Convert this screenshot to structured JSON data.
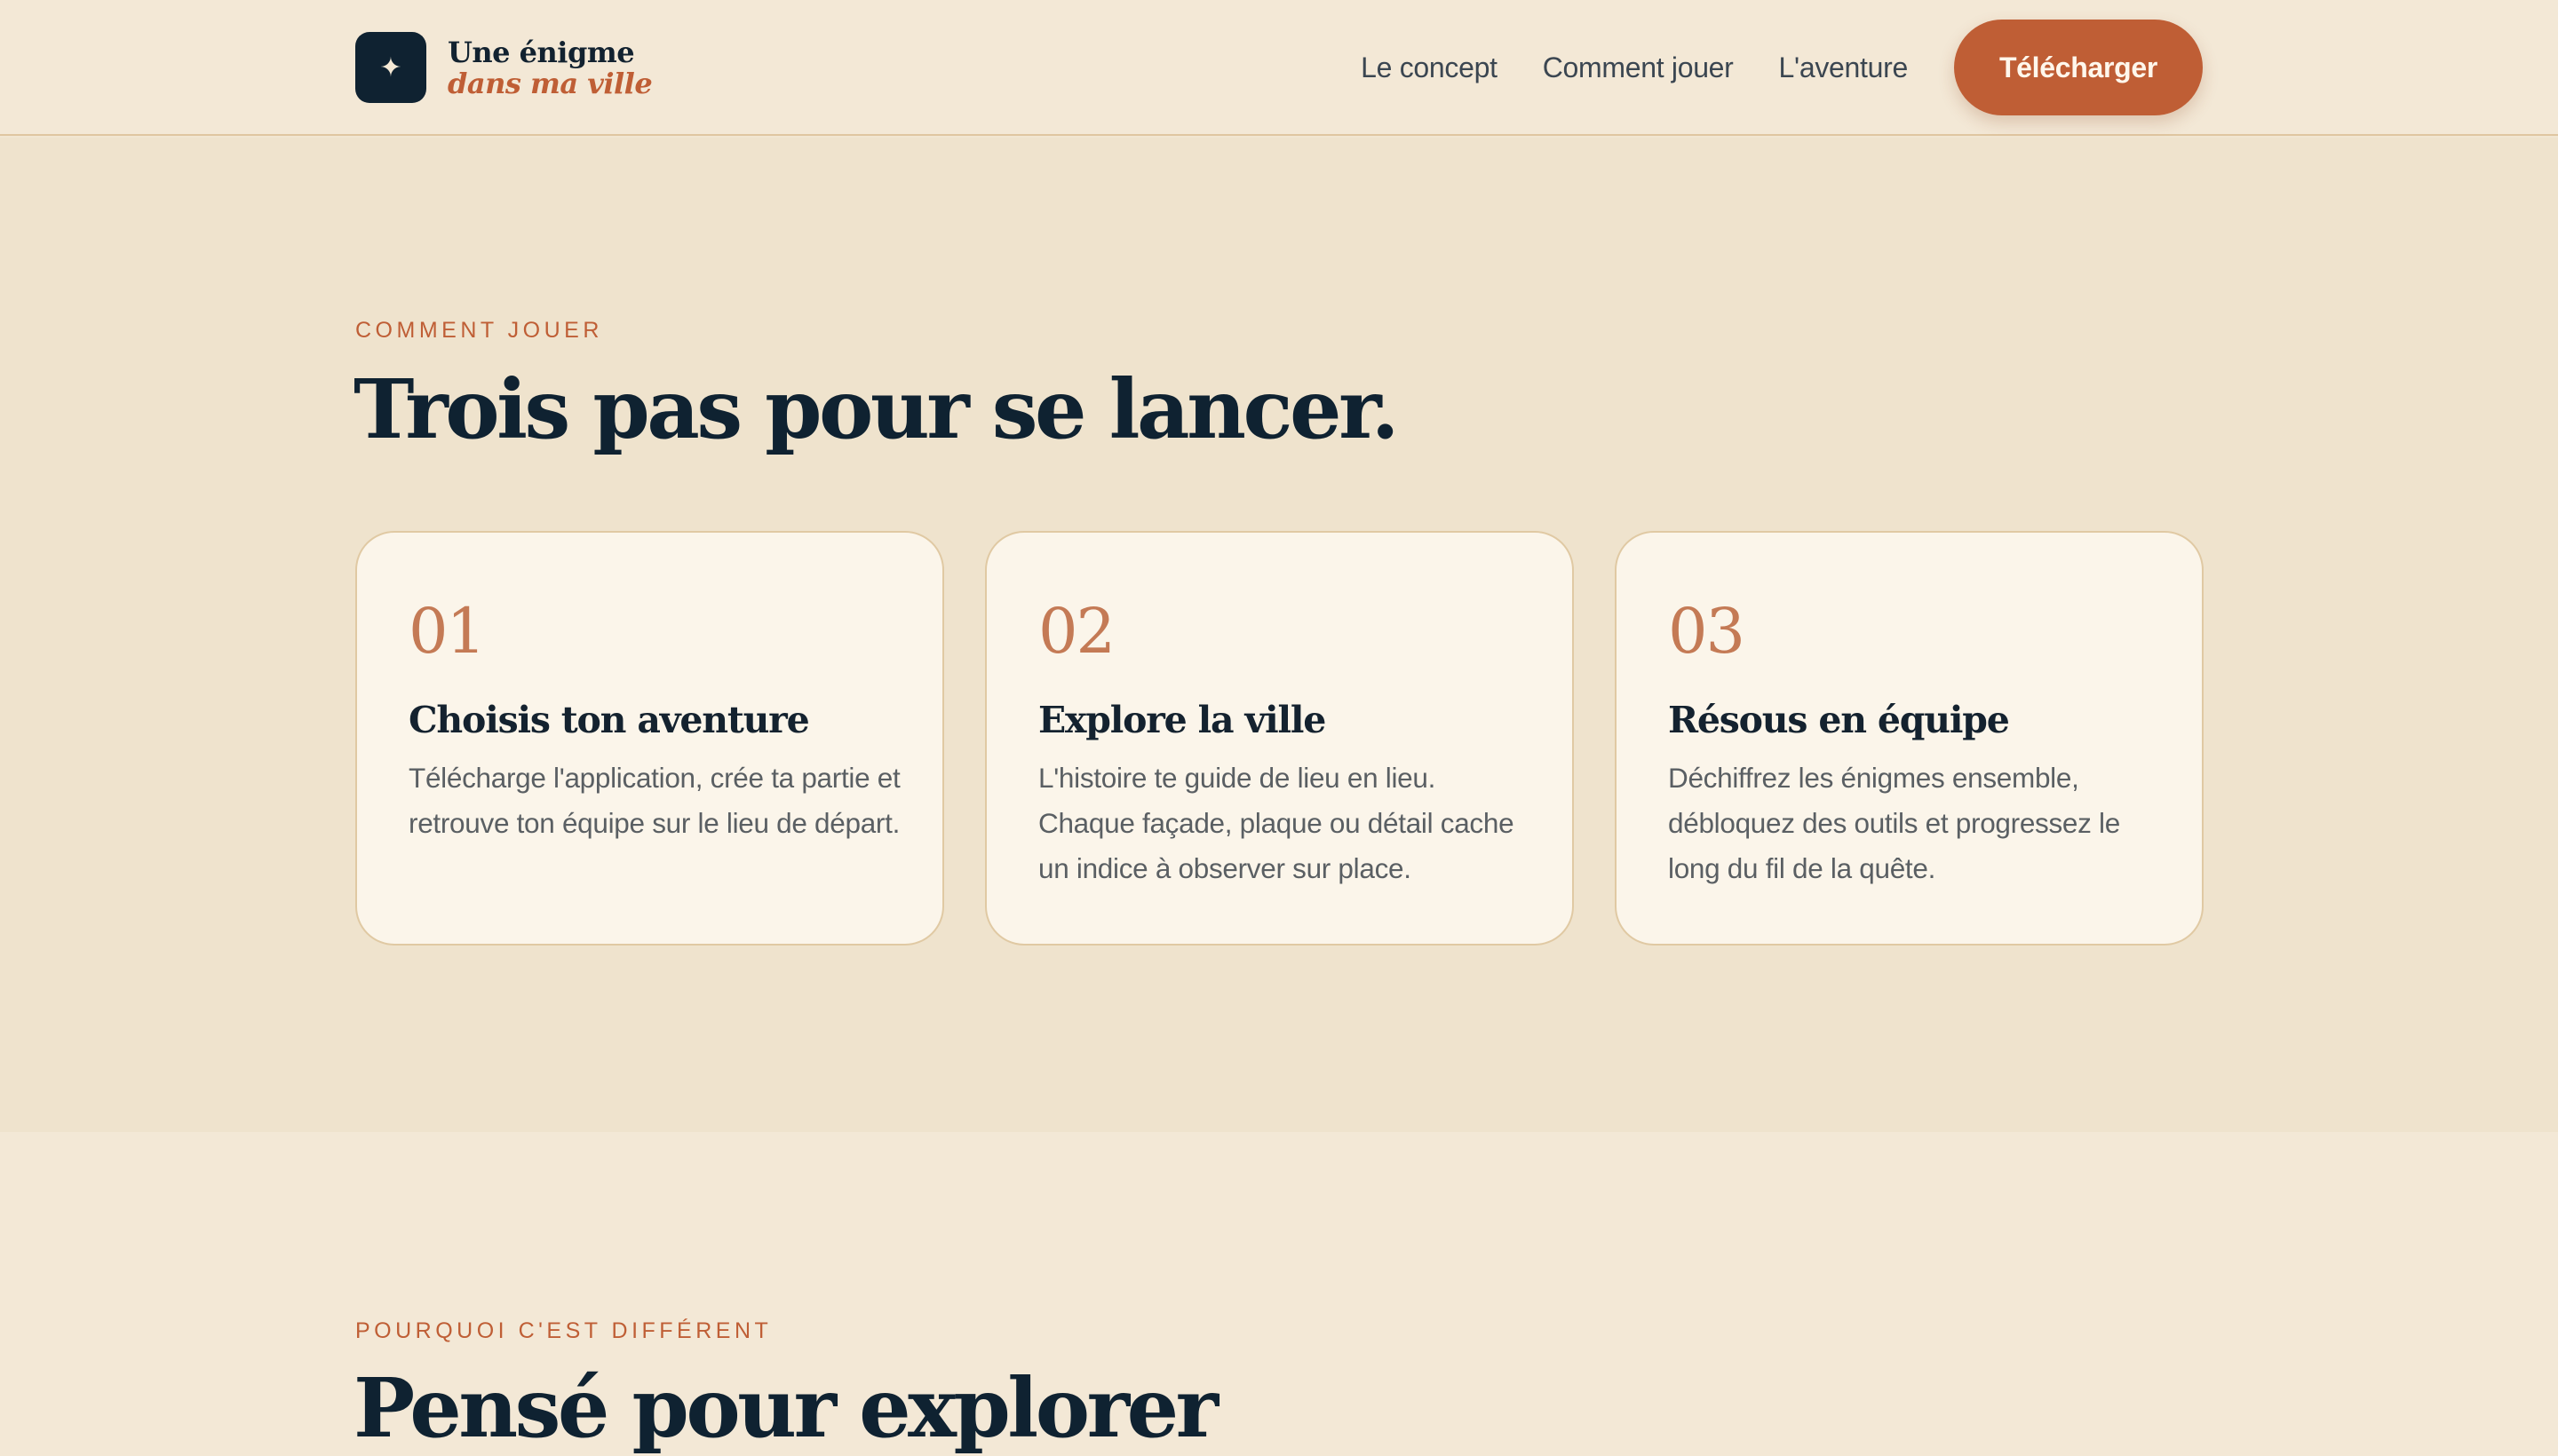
{
  "header": {
    "logo_line1": "Une énigme",
    "logo_line2": "dans ma ville",
    "logo_icon": "sparkle-icon",
    "nav": [
      "Le concept",
      "Comment jouer",
      "L'aventure"
    ],
    "cta_label": "Télécharger"
  },
  "how_to_play": {
    "eyebrow": "COMMENT JOUER",
    "title": "Trois pas pour se lancer.",
    "steps": [
      {
        "number": "01",
        "title": "Choisis ton aventure",
        "text": "Télécharge l'application, crée ta partie et retrouve ton équipe sur le lieu de départ."
      },
      {
        "number": "02",
        "title": "Explore la ville",
        "text": "L'histoire te guide de lieu en lieu. Chaque façade, plaque ou détail cache un indice à observer sur place."
      },
      {
        "number": "03",
        "title": "Résous en équipe",
        "text": "Déchiffrez les énigmes ensemble, débloquez des outils et progressez le long du fil de la quête."
      }
    ]
  },
  "why_different": {
    "eyebrow": "POURQUOI C'EST DIFFÉRENT",
    "title": "Pensé pour explorer"
  },
  "colors": {
    "accent": "#bf5e35",
    "navy": "#0f2231",
    "background": "#efe3cd",
    "card": "#fbf5ea"
  }
}
